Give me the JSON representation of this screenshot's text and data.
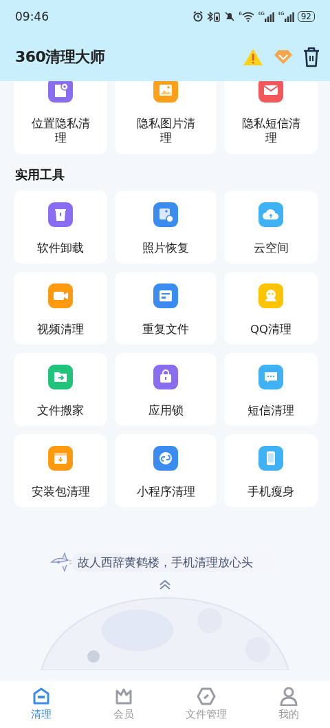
{
  "status_bar": {
    "time": "09:46",
    "wifi_badge": "6",
    "signals": [
      "4G",
      "4G"
    ],
    "battery": "92"
  },
  "header": {
    "title": "360清理大师"
  },
  "privacy_tools": [
    {
      "label": "位置隐私清理",
      "color": "#8a6cf0"
    },
    {
      "label": "隐私图片清理",
      "color": "#ff9f1a"
    },
    {
      "label": "隐私短信清理",
      "color": "#f2575c"
    }
  ],
  "section_title": "实用工具",
  "tools": [
    {
      "label": "软件卸载",
      "color": "#8a6cf0"
    },
    {
      "label": "照片恢复",
      "color": "#3b8cf0"
    },
    {
      "label": "云空间",
      "color": "#3fb2f5"
    },
    {
      "label": "视频清理",
      "color": "#ff9a10"
    },
    {
      "label": "重复文件",
      "color": "#3b8cf0"
    },
    {
      "label": "QQ清理",
      "color": "#ffc400"
    },
    {
      "label": "文件搬家",
      "color": "#1fc47a"
    },
    {
      "label": "应用锁",
      "color": "#8a6cf0"
    },
    {
      "label": "短信清理",
      "color": "#3fb2f5"
    },
    {
      "label": "安装包清理",
      "color": "#ff9a10"
    },
    {
      "label": "小程序清理",
      "color": "#3b8cf0"
    },
    {
      "label": "手机瘦身",
      "color": "#3fb2f5"
    }
  ],
  "slogan": "故人西辞黄鹤楼，手机清理放心头",
  "nav": [
    {
      "label": "清理",
      "selected": true
    },
    {
      "label": "会员",
      "selected": false
    },
    {
      "label": "文件管理",
      "selected": false
    },
    {
      "label": "我的",
      "selected": false
    }
  ]
}
